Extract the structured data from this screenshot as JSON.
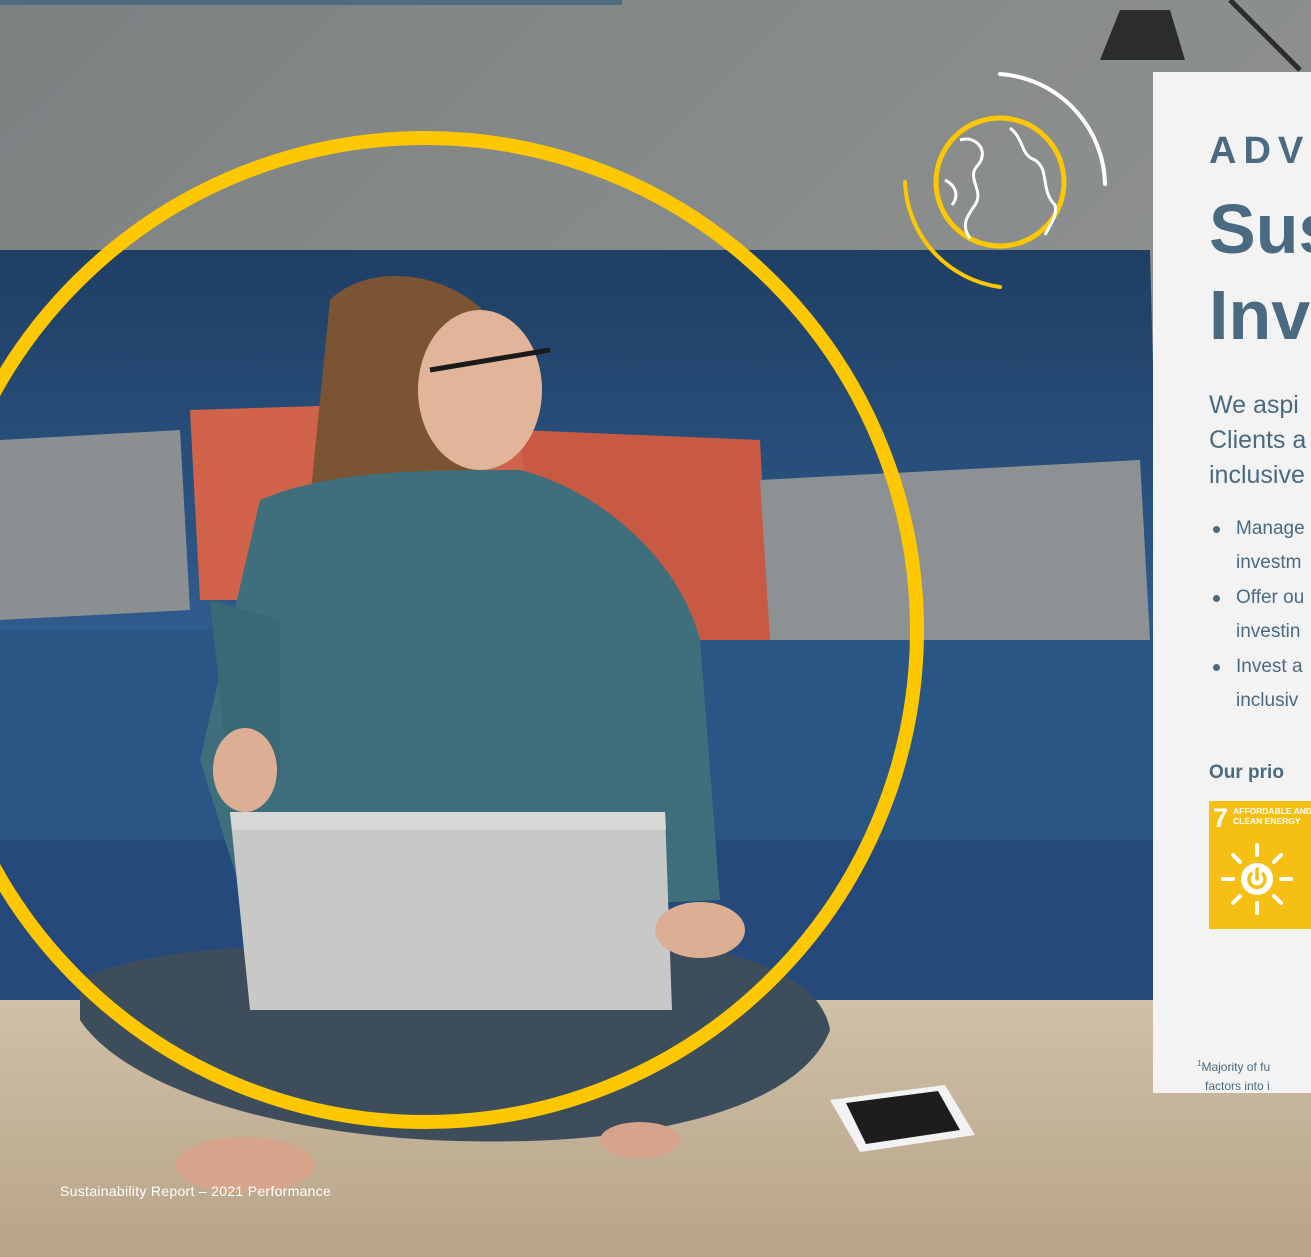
{
  "header": {
    "kicker": "ADV",
    "title_line1": "Sus",
    "title_line2": "Inv"
  },
  "intro": [
    "We aspi",
    "Clients a",
    "inclusive"
  ],
  "bullets": [
    [
      "Manage",
      "investm"
    ],
    [
      "Offer ou",
      "investin"
    ],
    [
      "Invest a",
      "inclusiv"
    ]
  ],
  "priorities_heading": "Our prio",
  "sdg_tile": {
    "number": "7",
    "label": "AFFORDABLE AND\nCLEAN ENERGY",
    "icon": "sun-power-icon",
    "color": "#f6bf13"
  },
  "footnote": {
    "marker": "1",
    "line1": "Majority of fu",
    "line2": "factors into i"
  },
  "footer": "Sustainability Report – 2021 Performance",
  "colors": {
    "accent_yellow": "#fdc800",
    "heading_blue": "#4a6a82",
    "panel_bg": "#f3f3f3"
  },
  "decor": {
    "globe": "globe-icon"
  }
}
